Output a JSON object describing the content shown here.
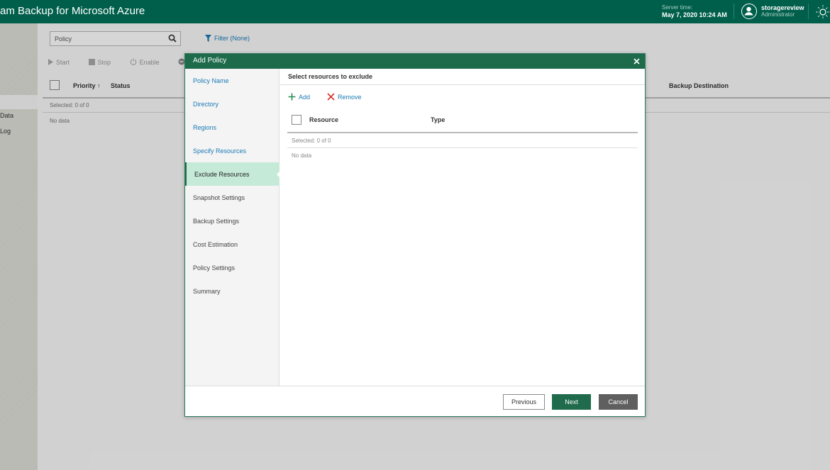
{
  "app": {
    "title": "am Backup for Microsoft Azure",
    "server_time_label": "Server time:",
    "server_time": "May 7, 2020 10:24 AM",
    "user_name": "storagereview",
    "user_role": "Administrator"
  },
  "leftnav": {
    "items": [
      "Data",
      "Log"
    ]
  },
  "background": {
    "search_value": "Policy",
    "filter_label": "Filter (None)",
    "toolbar": {
      "start": "Start",
      "stop": "Stop",
      "enable": "Enable"
    },
    "columns": {
      "priority": "Priority ↑",
      "status": "Status",
      "backup_destination": "Backup Destination"
    },
    "selected": "Selected:  0 of 0",
    "no_data": "No data"
  },
  "dialog": {
    "title": "Add Policy",
    "steps": [
      {
        "label": "Policy Name",
        "state": "done"
      },
      {
        "label": "Directory",
        "state": "done"
      },
      {
        "label": "Regions",
        "state": "done"
      },
      {
        "label": "Specify Resources",
        "state": "done"
      },
      {
        "label": "Exclude Resources",
        "state": "active"
      },
      {
        "label": "Snapshot Settings",
        "state": "pending"
      },
      {
        "label": "Backup Settings",
        "state": "pending"
      },
      {
        "label": "Cost Estimation",
        "state": "pending"
      },
      {
        "label": "Policy Settings",
        "state": "pending"
      },
      {
        "label": "Summary",
        "state": "pending"
      }
    ],
    "pane": {
      "title": "Select resources to exclude",
      "add_label": "Add",
      "remove_label": "Remove",
      "columns": {
        "resource": "Resource",
        "type": "Type"
      },
      "selected": "Selected:  0 of 0",
      "no_data": "No data"
    },
    "buttons": {
      "previous": "Previous",
      "next": "Next",
      "cancel": "Cancel"
    }
  },
  "colors": {
    "header": "#005f4b",
    "dialog_header": "#1e6b4c",
    "accent": "#1f6b4c",
    "link": "#1b7ab5",
    "active_step": "#c6ead8"
  }
}
